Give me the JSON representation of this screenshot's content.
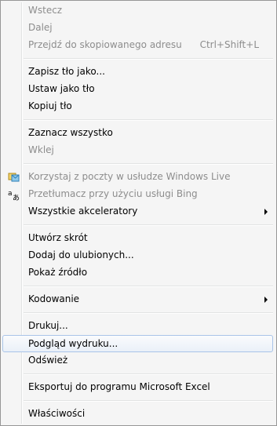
{
  "menu": {
    "back": "Wstecz",
    "forward": "Dalej",
    "goto_copied": "Przejdź do skopiowanego adresu",
    "goto_copied_shortcut": "Ctrl+Shift+L",
    "save_background": "Zapisz tło jako...",
    "set_background": "Ustaw jako tło",
    "copy_background": "Kopiuj tło",
    "select_all": "Zaznacz wszystko",
    "paste": "Wklej",
    "windows_live_mail": "Korzystaj z poczty w usłudze Windows Live",
    "bing_translate": "Przetłumacz przy użyciu usługi Bing",
    "all_accelerators": "Wszystkie akceleratory",
    "create_shortcut": "Utwórz skrót",
    "add_favorites": "Dodaj do ulubionych...",
    "view_source": "Pokaż źródło",
    "encoding": "Kodowanie",
    "print": "Drukuj...",
    "print_preview": "Podgląd wydruku...",
    "refresh": "Odśwież",
    "export_excel": "Eksportuj do programu Microsoft Excel",
    "properties": "Właściwości"
  },
  "colors": {
    "disabled_text": "#8d8d8d",
    "highlight_border": "#a9c4e8",
    "menu_background": "#f5f5f5"
  },
  "icons": {
    "windows_live_mail": "mail-icon",
    "bing_translate": "translate-icon"
  }
}
